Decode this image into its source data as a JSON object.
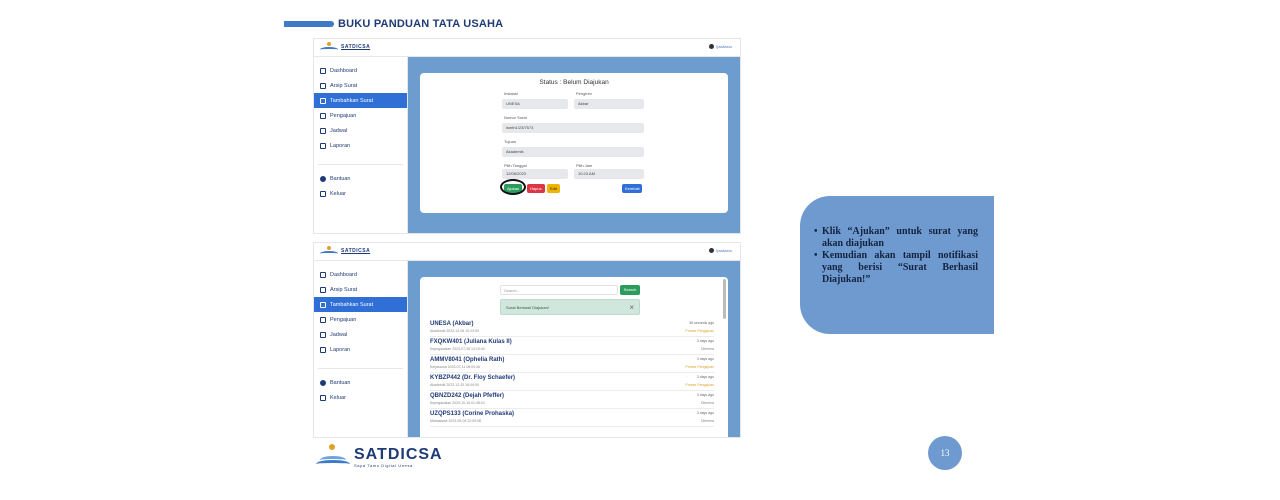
{
  "doc_title": "BUKU PANDUAN TATA USAHA",
  "app": {
    "logo_text": "SATDICSA",
    "user_label": "Ijaaliastu"
  },
  "sidebar": {
    "items": [
      {
        "label": "Dashboard"
      },
      {
        "label": "Arsip Surat"
      },
      {
        "label": "Tambahkan Surat"
      },
      {
        "label": "Pengajuan"
      },
      {
        "label": "Jadwal"
      },
      {
        "label": "Laporan"
      }
    ],
    "bottom_items": [
      {
        "label": "Bantuan"
      },
      {
        "label": "Keluar"
      }
    ]
  },
  "form": {
    "status": "Status : Belum Diajukan",
    "instansi_label": "Instansi",
    "instansi_value": "UNESA",
    "pengirim_label": "Pengirim",
    "pengirim_value": "Akbar",
    "nomor_label": "Nomor Surat",
    "nomor_value": "ismth1/23/7573",
    "tujuan_label": "Tujuan",
    "tujuan_value": "Akademik",
    "tanggal_label": "Pilih Tanggal",
    "tanggal_value": "12/06/2023",
    "jam_label": "Pilih Jam",
    "jam_value": "10:23 AM",
    "btn_ajukan": "Ajukan",
    "btn_hapus": "Hapus",
    "btn_edit": "Edit",
    "btn_kembali": "Kembali"
  },
  "list": {
    "search_placeholder": "Search...",
    "search_button": "Search",
    "alert_text": "Surat Berhasil Diajukan!",
    "alert_close": "×",
    "rows": [
      {
        "name": "UNESA (Akbar)",
        "sub": "Akademik 2023-12-06 10:23:00",
        "ago": "35 seconds ago",
        "status": "Proses Pengajuan",
        "color": "#e0a127"
      },
      {
        "name": "FXQKW401 (Juliana Kulas II)",
        "sub": "Kepegawaian 2023-07-28 13:15:40",
        "ago": "3 days ago",
        "status": "Diterima",
        "color": "#888888"
      },
      {
        "name": "AMMV8041 (Ophelia Rath)",
        "sub": "Kerjasama 2023-07-11 06:00:46",
        "ago": "3 days ago",
        "status": "Proses Pengajuan",
        "color": "#e0a127"
      },
      {
        "name": "KYBZP442 (Dr. Floy Schaefer)",
        "sub": "Akademik 2023-12-20 16:09:00",
        "ago": "3 days ago",
        "status": "Proses Pengajuan",
        "color": "#e0a127"
      },
      {
        "name": "QBNZD242 (Dejah Pfeffer)",
        "sub": "Kepegawaian 2023-10-16 01:38:24",
        "ago": "3 days ago",
        "status": "Diterima",
        "color": "#888888"
      },
      {
        "name": "UZQPS133 (Corine Prohaska)",
        "sub": "Mahasiswa 2023-05-04 22:09:08",
        "ago": "3 days ago",
        "status": "Diterima",
        "color": "#888888"
      }
    ]
  },
  "callout": {
    "items": [
      "Klik “Ajukan” untuk surat yang akan diajukan",
      "Kemudian akan tampil notifikasi yang berisi “Surat Berhasil Diajukan!”"
    ]
  },
  "footer": {
    "logo_text": "SATDICSA",
    "logo_tagline": "Sapa Tamu Digital Unesa",
    "page_number": "13"
  },
  "colors": {
    "accent_blue": "#2f6fd6",
    "panel_blue": "#6d9ccf",
    "success_green": "#2a9d5c",
    "danger_red": "#dc3545",
    "warning_yellow": "#f0b400"
  }
}
